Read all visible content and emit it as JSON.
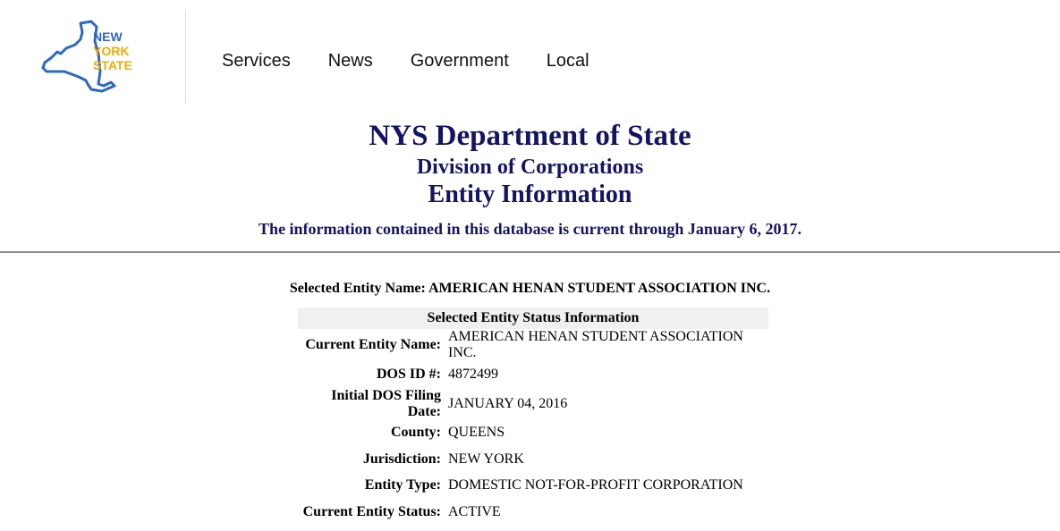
{
  "logo": {
    "line1": "NEW",
    "line2": "YORK",
    "line3": "STATE",
    "color_state": "#2d68c4",
    "color_text": "#f2a900"
  },
  "nav": {
    "items": [
      "Services",
      "News",
      "Government",
      "Local"
    ]
  },
  "header": {
    "title": "NYS Department of State",
    "subtitle": "Division of Corporations",
    "section": "Entity Information",
    "note": "The information contained in this database is current through January 6, 2017."
  },
  "entity": {
    "selected_label": "Selected Entity Name:",
    "selected_name": "AMERICAN HENAN STUDENT ASSOCIATION INC.",
    "status_header": "Selected Entity Status Information",
    "rows": [
      {
        "label": "Current Entity Name:",
        "value": "AMERICAN HENAN STUDENT ASSOCIATION INC."
      },
      {
        "label": "DOS ID #:",
        "value": "4872499"
      },
      {
        "label": "Initial DOS Filing Date:",
        "value": "JANUARY 04, 2016"
      },
      {
        "label": "County:",
        "value": "QUEENS"
      },
      {
        "label": "Jurisdiction:",
        "value": "NEW YORK"
      },
      {
        "label": "Entity Type:",
        "value": "DOMESTIC NOT-FOR-PROFIT CORPORATION"
      },
      {
        "label": "Current Entity Status:",
        "value": "ACTIVE"
      }
    ]
  },
  "colors": {
    "heading": "#141466",
    "rule": "#8c8c8c",
    "table_header_bg": "#f0f0ee"
  }
}
